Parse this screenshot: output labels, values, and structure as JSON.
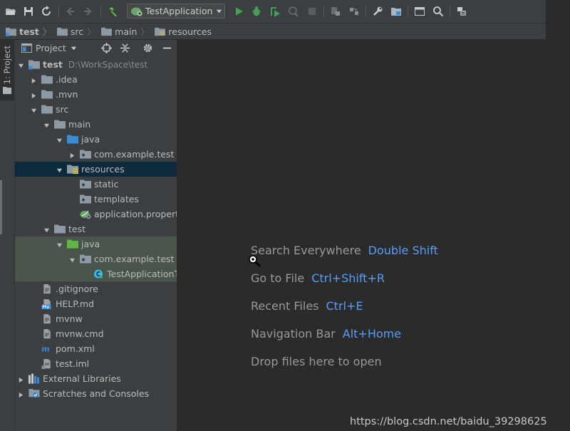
{
  "toolbar": {
    "run_config": "TestApplication"
  },
  "breadcrumb": [
    "test",
    "src",
    "main",
    "resources"
  ],
  "tool_window_stripe": {
    "label": "1: Project"
  },
  "project_panel": {
    "title": "Project",
    "tree": [
      {
        "label": "test",
        "path": "D:\\WorkSpace\\test",
        "icon": "module-folder-icon",
        "depth": 0,
        "expanded": true,
        "bold": true
      },
      {
        "label": ".idea",
        "icon": "folder-icon",
        "depth": 1,
        "expanded": false
      },
      {
        "label": ".mvn",
        "icon": "folder-icon",
        "depth": 1,
        "expanded": false
      },
      {
        "label": "src",
        "icon": "folder-icon",
        "depth": 1,
        "expanded": true
      },
      {
        "label": "main",
        "icon": "folder-icon",
        "depth": 2,
        "expanded": true
      },
      {
        "label": "java",
        "icon": "source-folder-icon",
        "depth": 3,
        "expanded": true
      },
      {
        "label": "com.example.test",
        "icon": "package-icon",
        "depth": 4,
        "expanded": false
      },
      {
        "label": "resources",
        "icon": "resources-folder-icon",
        "depth": 3,
        "expanded": true,
        "selected": true
      },
      {
        "label": "static",
        "icon": "package-icon",
        "depth": 4
      },
      {
        "label": "templates",
        "icon": "package-icon",
        "depth": 4
      },
      {
        "label": "application.properties",
        "icon": "spring-properties-icon",
        "depth": 4
      },
      {
        "label": "test",
        "icon": "folder-icon",
        "depth": 2,
        "expanded": true
      },
      {
        "label": "java",
        "icon": "test-source-folder-icon",
        "depth": 3,
        "expanded": true,
        "test": true
      },
      {
        "label": "com.example.test",
        "icon": "package-icon",
        "depth": 4,
        "expanded": true,
        "test": true
      },
      {
        "label": "TestApplicationTests",
        "icon": "java-class-icon",
        "depth": 5,
        "test": true
      },
      {
        "label": ".gitignore",
        "icon": "file-icon",
        "depth": 1
      },
      {
        "label": "HELP.md",
        "icon": "markdown-file-icon",
        "depth": 1
      },
      {
        "label": "mvnw",
        "icon": "file-icon",
        "depth": 1
      },
      {
        "label": "mvnw.cmd",
        "icon": "file-icon",
        "depth": 1
      },
      {
        "label": "pom.xml",
        "icon": "maven-icon",
        "depth": 1
      },
      {
        "label": "test.iml",
        "icon": "iml-file-icon",
        "depth": 1
      },
      {
        "label": "External Libraries",
        "icon": "libraries-icon",
        "depth": 0,
        "expanded": false
      },
      {
        "label": "Scratches and Consoles",
        "icon": "scratches-icon",
        "depth": 0,
        "expanded": false
      }
    ]
  },
  "editor_hints": [
    {
      "text": "Search Everywhere",
      "key": "Double Shift"
    },
    {
      "text": "Go to File",
      "key": "Ctrl+Shift+R"
    },
    {
      "text": "Recent Files",
      "key": "Ctrl+E"
    },
    {
      "text": "Navigation Bar",
      "key": "Alt+Home"
    },
    {
      "text": "Drop files here to open",
      "key": ""
    }
  ],
  "watermark": "https://blog.csdn.net/baidu_39298625",
  "colors": {
    "background": "#2b2b2b",
    "panel": "#3c3f41",
    "selection": "#0d293e",
    "test_row": "#49544a",
    "hint_key": "#589df6",
    "run_green": "#499c54",
    "folder": "#8d9aa6",
    "source_folder": "#3d8bd8"
  }
}
